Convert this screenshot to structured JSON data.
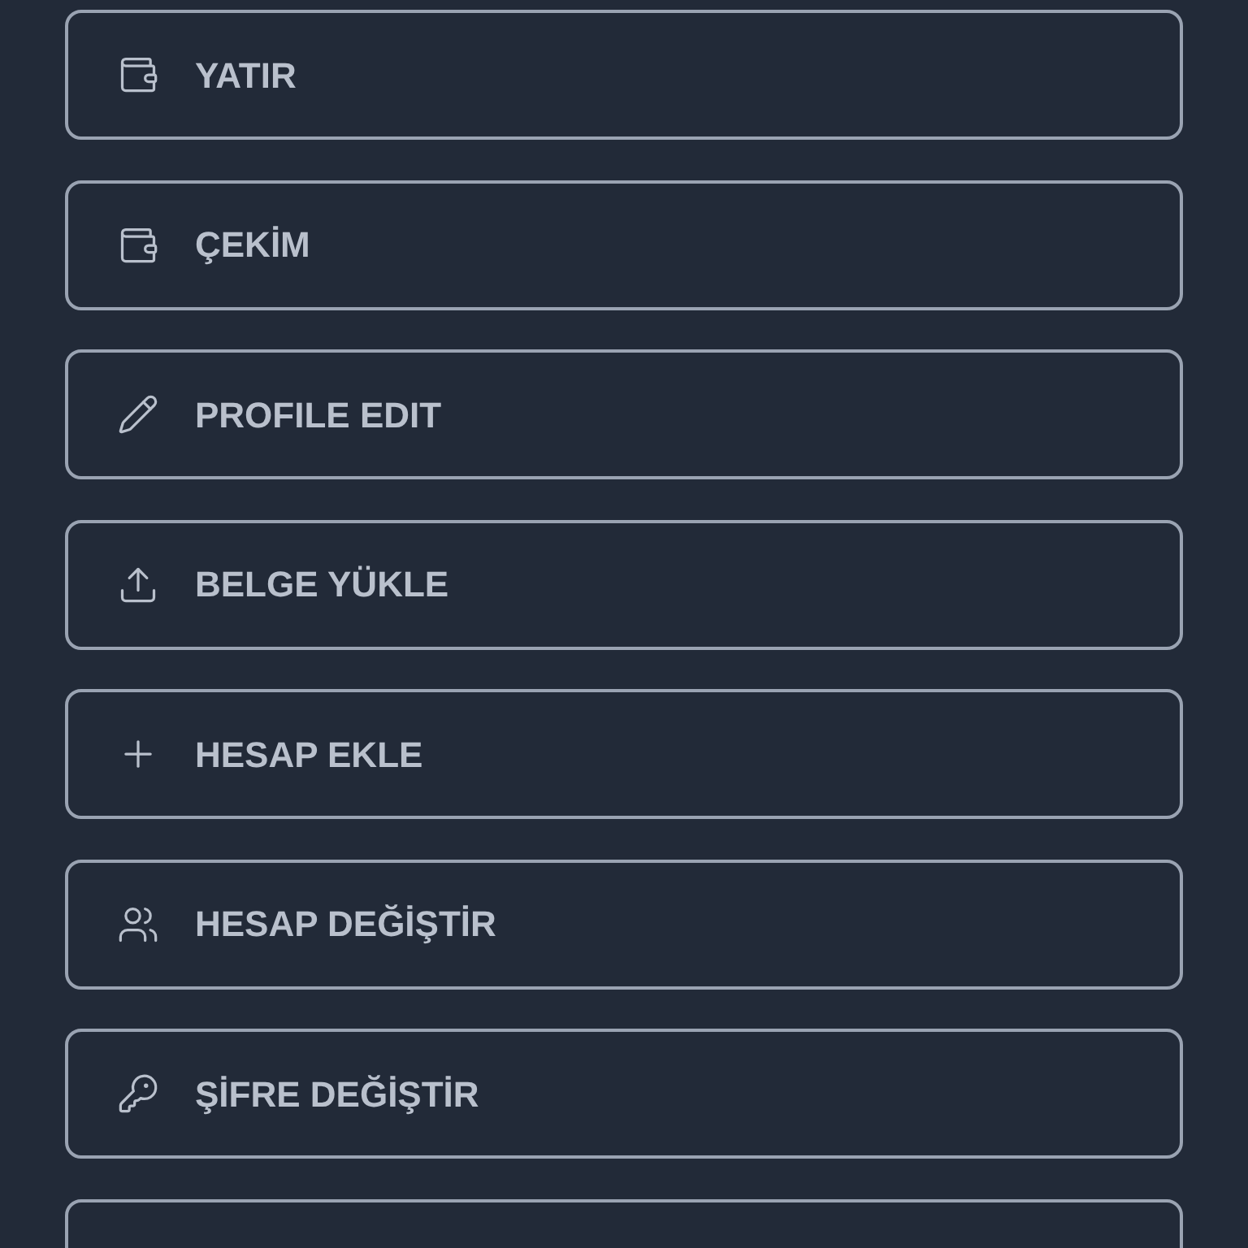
{
  "menu_items": [
    {
      "label": "YATIR"
    },
    {
      "label": "ÇEKİM"
    },
    {
      "label": "PROFILE EDIT"
    },
    {
      "label": "BELGE YÜKLE"
    },
    {
      "label": "HESAP EKLE"
    },
    {
      "label": "HESAP DEĞİŞTİR"
    },
    {
      "label": "ŞİFRE DEĞİŞTİR"
    }
  ]
}
